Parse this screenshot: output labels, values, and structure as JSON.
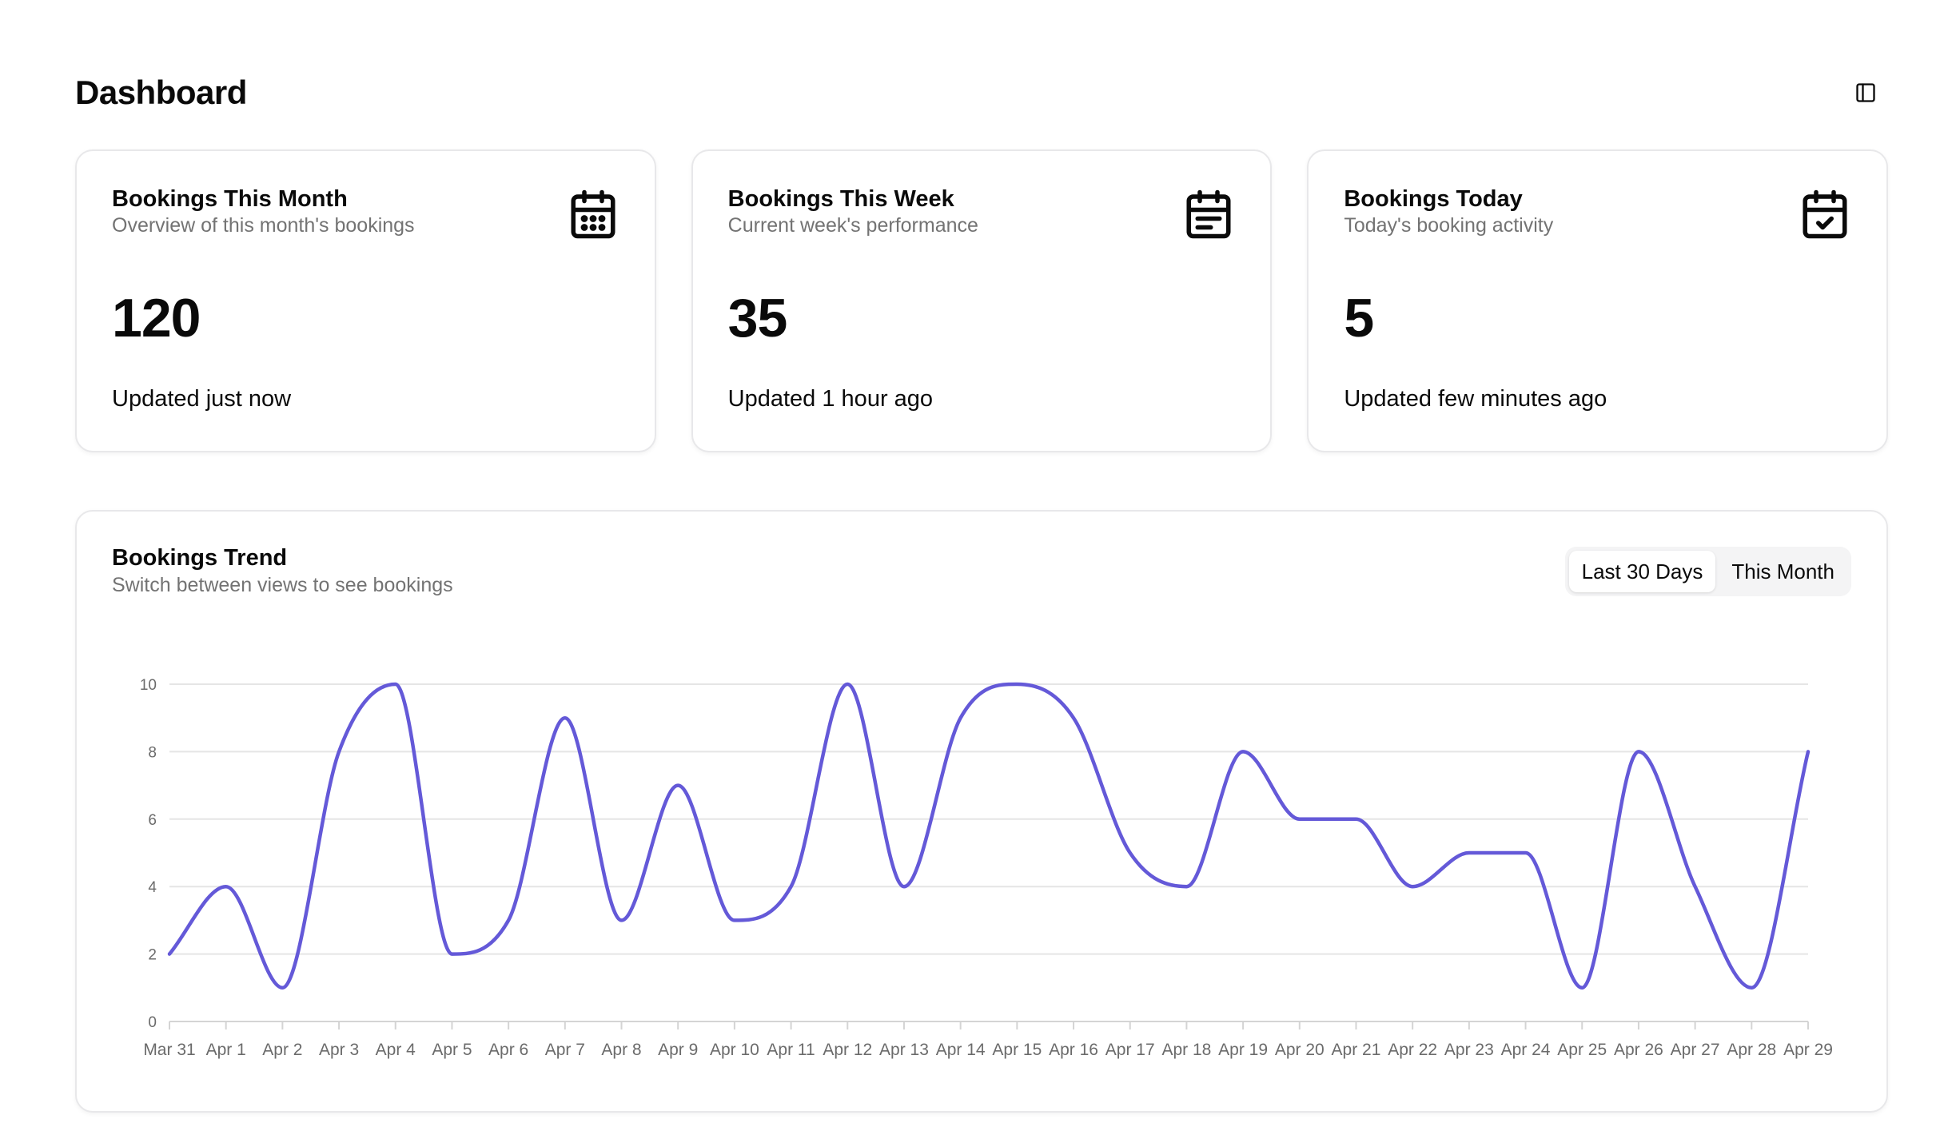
{
  "header": {
    "title": "Dashboard",
    "sidebar_icon": "panel-left-icon"
  },
  "cards": [
    {
      "title": "Bookings This Month",
      "subtitle": "Overview of this month's bookings",
      "value": "120",
      "footer": "Updated just now",
      "icon": "calendar-grid-icon"
    },
    {
      "title": "Bookings This Week",
      "subtitle": "Current week's performance",
      "value": "35",
      "footer": "Updated 1 hour ago",
      "icon": "calendar-list-icon"
    },
    {
      "title": "Bookings Today",
      "subtitle": "Today's booking activity",
      "value": "5",
      "footer": "Updated few minutes ago",
      "icon": "calendar-check-icon"
    }
  ],
  "trend": {
    "title": "Bookings Trend",
    "subtitle": "Switch between views to see bookings",
    "toggles": [
      {
        "label": "Last 30 Days",
        "active": true
      },
      {
        "label": "This Month",
        "active": false
      }
    ]
  },
  "colors": {
    "line": "#6459d8",
    "grid": "#e5e5e5",
    "border": "#e8e8ea"
  },
  "chart_data": {
    "type": "line",
    "x": [
      "Mar 31",
      "Apr 1",
      "Apr 2",
      "Apr 3",
      "Apr 4",
      "Apr 5",
      "Apr 6",
      "Apr 7",
      "Apr 8",
      "Apr 9",
      "Apr 10",
      "Apr 11",
      "Apr 12",
      "Apr 13",
      "Apr 14",
      "Apr 15",
      "Apr 16",
      "Apr 17",
      "Apr 18",
      "Apr 19",
      "Apr 20",
      "Apr 21",
      "Apr 22",
      "Apr 23",
      "Apr 24",
      "Apr 25",
      "Apr 26",
      "Apr 27",
      "Apr 28",
      "Apr 29"
    ],
    "series": [
      {
        "values": [
          2,
          4,
          1,
          8,
          10,
          2,
          3,
          9,
          3,
          7,
          3,
          4,
          10,
          4,
          9,
          10,
          9,
          5,
          4,
          8,
          6,
          6,
          4,
          5,
          5,
          1,
          8,
          4,
          1,
          8
        ]
      }
    ],
    "yticks": [
      0,
      2,
      4,
      6,
      8,
      10
    ],
    "ylim": [
      0,
      10
    ],
    "grid": true
  }
}
